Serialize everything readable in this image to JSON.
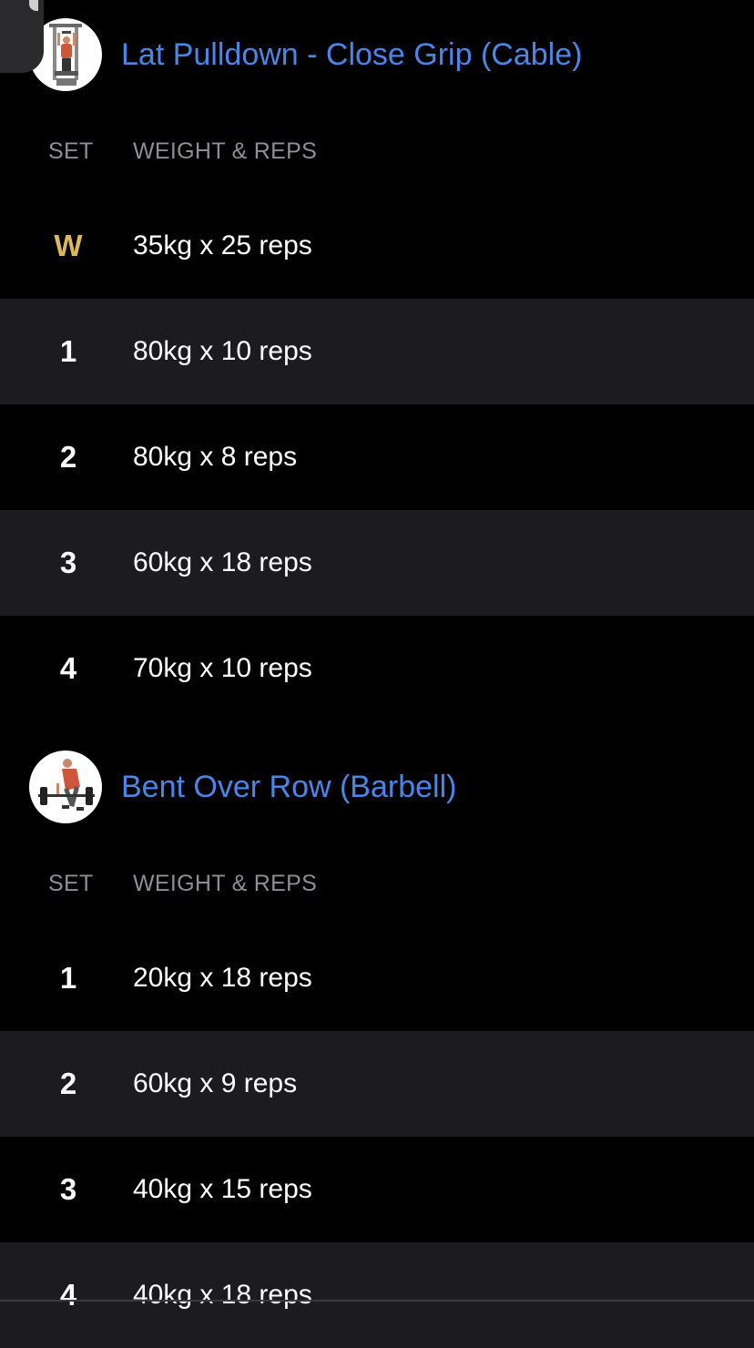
{
  "exercises": [
    {
      "title": "Lat Pulldown - Close Grip (Cable)",
      "thumb_icon": "lat-pulldown-exercise-icon",
      "col_set": "SET",
      "col_weight_reps": "WEIGHT & REPS",
      "sets": [
        {
          "label": "W",
          "value": "35kg x 25 reps",
          "type": "warmup"
        },
        {
          "label": "1",
          "value": "80kg x 10 reps",
          "type": "normal"
        },
        {
          "label": "2",
          "value": "80kg x 8 reps",
          "type": "normal"
        },
        {
          "label": "3",
          "value": "60kg x 18 reps",
          "type": "normal"
        },
        {
          "label": "4",
          "value": "70kg x 10 reps",
          "type": "normal"
        }
      ]
    },
    {
      "title": "Bent Over Row (Barbell)",
      "thumb_icon": "barbell-row-exercise-icon",
      "col_set": "SET",
      "col_weight_reps": "WEIGHT & REPS",
      "sets": [
        {
          "label": "1",
          "value": "20kg x 18 reps",
          "type": "normal"
        },
        {
          "label": "2",
          "value": "60kg x 9 reps",
          "type": "normal"
        },
        {
          "label": "3",
          "value": "40kg x 15 reps",
          "type": "normal"
        },
        {
          "label": "4",
          "value": "40kg x 18 reps",
          "type": "normal"
        }
      ]
    }
  ],
  "colors": {
    "background": "#000000",
    "row_alt": "#1c1c1e",
    "title_accent": "#4a86e8",
    "warmup": "#e0b85c",
    "header_text": "#8e8e93"
  }
}
